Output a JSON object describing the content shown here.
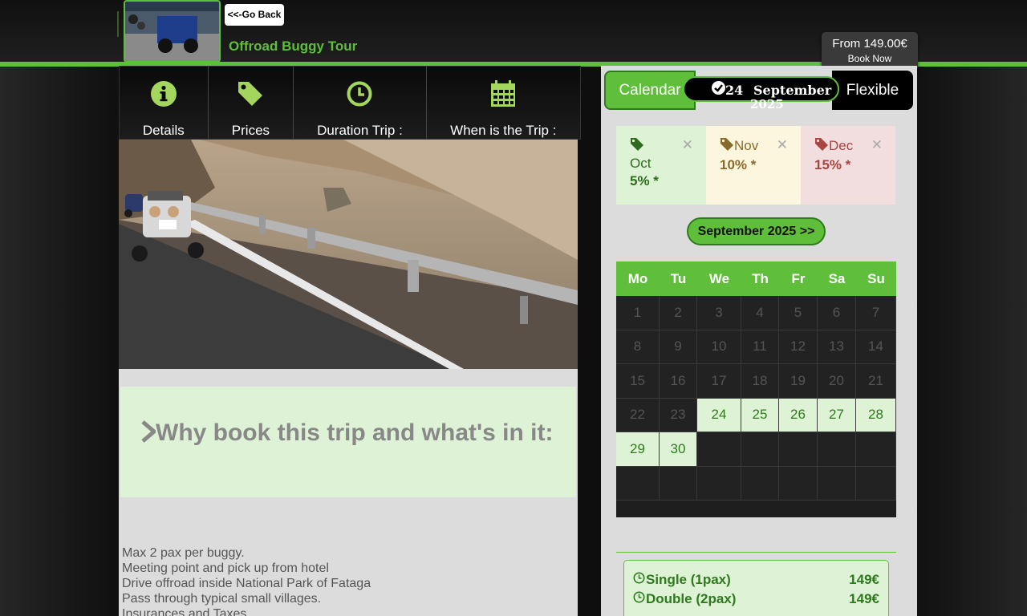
{
  "header": {
    "back_label": "<<-Go Back",
    "title": "Offroad Buggy Tour",
    "price": "From 149.00€",
    "book_label": "Book Now"
  },
  "tabs": [
    {
      "label": "Details",
      "icon": "info-icon"
    },
    {
      "label": "Prices",
      "icon": "tag-icon"
    },
    {
      "label": "Duration Trip :",
      "icon": "clock-icon"
    },
    {
      "label": "When is the Trip :",
      "icon": "calendar-icon"
    }
  ],
  "why": {
    "heading": "Why book this trip and what's in it:"
  },
  "bullets": [
    "Max 2 pax per buggy.",
    "Meeting point and pick up from hotel",
    "Drive offroad inside National Park of Fataga",
    "Pass through typical small villages.",
    "Insurances and Taxes"
  ],
  "booking": {
    "calendar_label": "Calendar",
    "flexible_label": "Flexible",
    "selected_day": "24",
    "selected_month": "September",
    "selected_year": "2025"
  },
  "promos": [
    {
      "month": "Oct",
      "discount": "5% *",
      "bg": "#def2d6",
      "color": "#2e6b1f"
    },
    {
      "month": "Nov",
      "discount": "10% *",
      "bg": "#fdf6de",
      "color": "#8a6a2a"
    },
    {
      "month": "Dec",
      "discount": "15% *",
      "bg": "#f2dede",
      "color": "#a94442"
    }
  ],
  "calendar": {
    "month_label": "September 2025 >>",
    "weekdays": [
      "Mo",
      "Tu",
      "We",
      "Th",
      "Fr",
      "Sa",
      "Su"
    ],
    "rows": [
      [
        {
          "d": "1",
          "s": "past"
        },
        {
          "d": "2",
          "s": "past"
        },
        {
          "d": "3",
          "s": "past"
        },
        {
          "d": "4",
          "s": "past"
        },
        {
          "d": "5",
          "s": "past"
        },
        {
          "d": "6",
          "s": "past"
        },
        {
          "d": "7",
          "s": "past"
        }
      ],
      [
        {
          "d": "8",
          "s": "past"
        },
        {
          "d": "9",
          "s": "past"
        },
        {
          "d": "10",
          "s": "past"
        },
        {
          "d": "11",
          "s": "past"
        },
        {
          "d": "12",
          "s": "past"
        },
        {
          "d": "13",
          "s": "past"
        },
        {
          "d": "14",
          "s": "past"
        }
      ],
      [
        {
          "d": "15",
          "s": "past"
        },
        {
          "d": "16",
          "s": "past"
        },
        {
          "d": "17",
          "s": "past"
        },
        {
          "d": "18",
          "s": "past"
        },
        {
          "d": "19",
          "s": "past"
        },
        {
          "d": "20",
          "s": "past"
        },
        {
          "d": "21",
          "s": "past"
        }
      ],
      [
        {
          "d": "22",
          "s": "past"
        },
        {
          "d": "23",
          "s": "past"
        },
        {
          "d": "24",
          "s": "avail"
        },
        {
          "d": "25",
          "s": "avail"
        },
        {
          "d": "26",
          "s": "avail"
        },
        {
          "d": "27",
          "s": "avail"
        },
        {
          "d": "28",
          "s": "avail"
        }
      ],
      [
        {
          "d": "29",
          "s": "avail"
        },
        {
          "d": "30",
          "s": "avail"
        },
        {
          "d": "",
          "s": "empty"
        },
        {
          "d": "",
          "s": "empty"
        },
        {
          "d": "",
          "s": "empty"
        },
        {
          "d": "",
          "s": "empty"
        },
        {
          "d": "",
          "s": "empty"
        }
      ],
      [
        {
          "d": "",
          "s": "empty"
        },
        {
          "d": "",
          "s": "empty"
        },
        {
          "d": "",
          "s": "empty"
        },
        {
          "d": "",
          "s": "empty"
        },
        {
          "d": "",
          "s": "empty"
        },
        {
          "d": "",
          "s": "empty"
        },
        {
          "d": "",
          "s": "empty"
        }
      ]
    ]
  },
  "price_options": [
    {
      "name": "Single (1pax)",
      "price": "149€"
    },
    {
      "name": "Double (2pax)",
      "price": "149€"
    }
  ],
  "colors": {
    "accent": "#5fbf3a",
    "accent_dark": "#2e7a1c",
    "light_green": "#def2d6"
  }
}
